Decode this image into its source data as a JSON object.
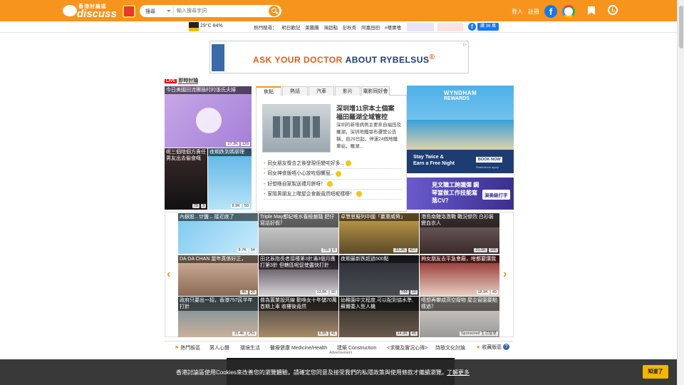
{
  "header": {
    "logo_text_top": "香港討論區",
    "logo_text": "discuss",
    "search_scope": "搜尋",
    "search_placeholder": "輸入搜尋字詞",
    "login": "登入",
    "register": "註冊"
  },
  "strip": {
    "weather": "29°C 84%",
    "hot_label": "熱門搜尋：",
    "hot": [
      "明日歡記",
      "萊騰騰",
      "灣超點",
      "彭秋秀",
      "阿嘉田田",
      "#嗜實嗜"
    ],
    "like_count": "讚 36 萬"
  },
  "ad_top": {
    "text_a": "ASK YOUR DOCTOR ",
    "text_b": "ABOUT RYBELSUS",
    "reg": "®"
  },
  "live": {
    "tag": "LIVE",
    "title": "即時討論"
  },
  "left_tiles": [
    {
      "caption": "今日美國回流團插村的張氏夫婦",
      "views": "17.2K",
      "comments": "120"
    },
    {
      "caption": "呢三個陰個方責任男友出去偷食嘅",
      "views": "70",
      "comments": "3"
    },
    {
      "caption": "夜期跌到媽聊理",
      "views": "8.9K",
      "comments": "50"
    }
  ],
  "tabs": [
    "焦點",
    "熱話",
    "汽車",
    "影片",
    "電影同好會"
  ],
  "feature": {
    "headline": "深圳增11宗本土個案 福田羅湖全域管控",
    "summary": "深圳的新增病例主要來自福田及羅湖，深圳地鐵發布遷營公告稱，自29日起，停運24個地鐵車站，羅湖...",
    "bullets": [
      "同女朋友復合之後發現佢變咗好多...",
      "同女神食飯唔小心放咗個響屁...",
      "好想喺自家製送禮月餅呀！",
      "家阻男朋友上嚟屋企食飯竟然唔呢樣嘢！"
    ]
  },
  "ad_right": {
    "brand": "WYNDHAM",
    "brand2": "REWARDS",
    "line1": "Stay Twice &",
    "line2": "Earn a Free Night",
    "book": "BOOK NOW",
    "restrict": "Restrictions apply."
  },
  "job_ad": {
    "text": "見文職工跨識彈 鋼琴當做工作技能寫落CV？",
    "button": "演奏級打字"
  },
  "grid": [
    {
      "caption": "內銀股...廿鹽... 接近底了",
      "views": "8.7K",
      "comments": "54"
    },
    {
      "caption": "Triple May都紀唯水養極嚴騷 肥仔寫話好假？",
      "views": "730",
      "comments": "6"
    },
    {
      "caption": "卓慧思擬列中國「贏重威脅」",
      "views": "33.2K",
      "comments": "417"
    },
    {
      "caption": "港島南鰻洛激戰 戰況慘烈 白衫裝變血衣人",
      "views": "21.5K",
      "comments": "166"
    },
    {
      "caption": "DA DA CHAN 當年真係好正，",
      "views": "4K",
      "comments": "25"
    },
    {
      "caption": "田北辰指長者接種第3針滿3個月應打第3針 但轄區呢促使盡快打針",
      "views": "13.8K",
      "comments": "93"
    },
    {
      "caption": "夜期最新跌超過500點",
      "views": "744",
      "comments": "10"
    },
    {
      "caption": "夠女朋友去平急會廠，咁都要講我",
      "views": "18.9K",
      "comments": "49"
    },
    {
      "caption": "政府只要出一招，香港757民半年打針",
      "views": "15.4K",
      "comments": "251"
    },
    {
      "caption": "普為置業設死線 勸喚女十年儲70萬首期上車 收樓後竟然",
      "views": "6.9K",
      "comments": "41"
    },
    {
      "caption": "幼稚園中文程度,可以配到協水準,蘇爾委入型人機",
      "views": "14.3K",
      "comments": "45"
    },
    {
      "caption": "唔想再攀成高空廢物 屋企窗園要點樣過？",
      "views": "Sponsored 生活智慧",
      "comments": ""
    }
  ],
  "bottom_nav": [
    "熱門板區",
    "男人心聲",
    "環境生活",
    "醫療健康 Medicine/Health",
    "建築 Construction",
    "<求職及實況心得>",
    "詩歌文化討論"
  ],
  "bookmark_text": "收藏版區",
  "advertisement": "Advertisement",
  "cookie": {
    "message": "香港討論區使用Cookies來改善您的瀏覽體驗。請確定您同意及接受我們的私隱政策與使用條款才繼續瀏覽。",
    "more": "了解更多",
    "ok": "知道了"
  },
  "colors": {
    "brand": "#f7941d",
    "live": "#e00000",
    "cookie_btn": "#f7b500"
  }
}
